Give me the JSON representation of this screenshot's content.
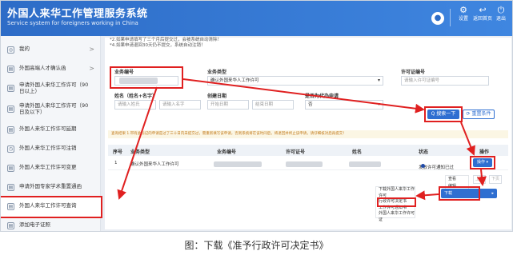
{
  "header": {
    "title": "外国人来华工作管理服务系统",
    "subtitle": "Service system for foreigners working in China",
    "avatar_glyph": "●",
    "buttons": [
      {
        "label": "设置",
        "icon": "gear-icon",
        "glyph": "⚙"
      },
      {
        "label": "返回首页",
        "icon": "back-icon",
        "glyph": "↩"
      },
      {
        "label": "退出",
        "icon": "logout-icon",
        "glyph": "⏻"
      }
    ]
  },
  "sidebar": {
    "items": [
      {
        "label": "我的",
        "arrow": ">",
        "glyph": "◎"
      },
      {
        "label": "外国高端人才确认函",
        "arrow": ">",
        "glyph": "▤"
      },
      {
        "label": "申请外国人来华工作许可（90日以上）",
        "arrow": "",
        "glyph": "▤"
      },
      {
        "label": "申请外国人来华工作许可（90日及以下）",
        "arrow": "",
        "glyph": "▤"
      },
      {
        "label": "外国人来华工作许可延期",
        "arrow": "",
        "glyph": "▤"
      },
      {
        "label": "外国人来华工作许可注销",
        "arrow": "",
        "glyph": "◷"
      },
      {
        "label": "外国人来华工作许可变更",
        "arrow": "",
        "glyph": "▤"
      },
      {
        "label": "申请外国专家学术重置通函",
        "arrow": "",
        "glyph": "▤"
      },
      {
        "label": "外国人来华工作许可查询",
        "arrow": "",
        "glyph": "▤"
      },
      {
        "label": "添加电子证照",
        "arrow": "",
        "glyph": "▤"
      }
    ]
  },
  "notes": [
    "*2.如果申请填写了三个月后提交过，会被系统自动清除！",
    "*4.如果申请退回30天仍不提交，系统自动注销！"
  ],
  "form": {
    "business_no_label": "业务编号",
    "business_type_label": "业务类型",
    "business_type_value": "确认外国来华人工作许可",
    "permit_no_label": "许可证编号",
    "permit_no_placeholder": "请输入许可证编号",
    "name_label": "姓名（姓名+名字）",
    "surname_placeholder": "请输入姓氏",
    "given_placeholder": "请输入名字",
    "create_date_label": "创建日期",
    "start_date_placeholder": "开始日期",
    "end_date_placeholder": "结束日期",
    "proxy_label": "是否为代办申请",
    "proxy_value": "否",
    "search_button": "Q 搜索一下",
    "reset_button": "⟳ 重置条件"
  },
  "tip": "查询结果 1.带有此标记的申请是过了三十日内未提交过，需重新填写该申请，否则系统将在该时间后，将退回并终止该申请，请仔细核对后再提交！",
  "table": {
    "headers": [
      "序号",
      "业务类型",
      "业务编号",
      "许可证号",
      "姓名",
      "状态",
      "操作"
    ],
    "rows": [
      {
        "index": "1",
        "type": "确认外国来华人工作许可",
        "status": "发放许可通知已过"
      }
    ],
    "op_button": "操作 ▾"
  },
  "op_menu": [
    "查看",
    "编辑"
  ],
  "pager": [
    "上页",
    "下页"
  ],
  "download_button": "下载",
  "download_menu": [
    "下载外国人来华工作许可",
    "行政许可决定书",
    "工作许可通知书",
    "外国人来华工作许可证"
  ],
  "caption": "图：下载《准予行政许可决定书》"
}
